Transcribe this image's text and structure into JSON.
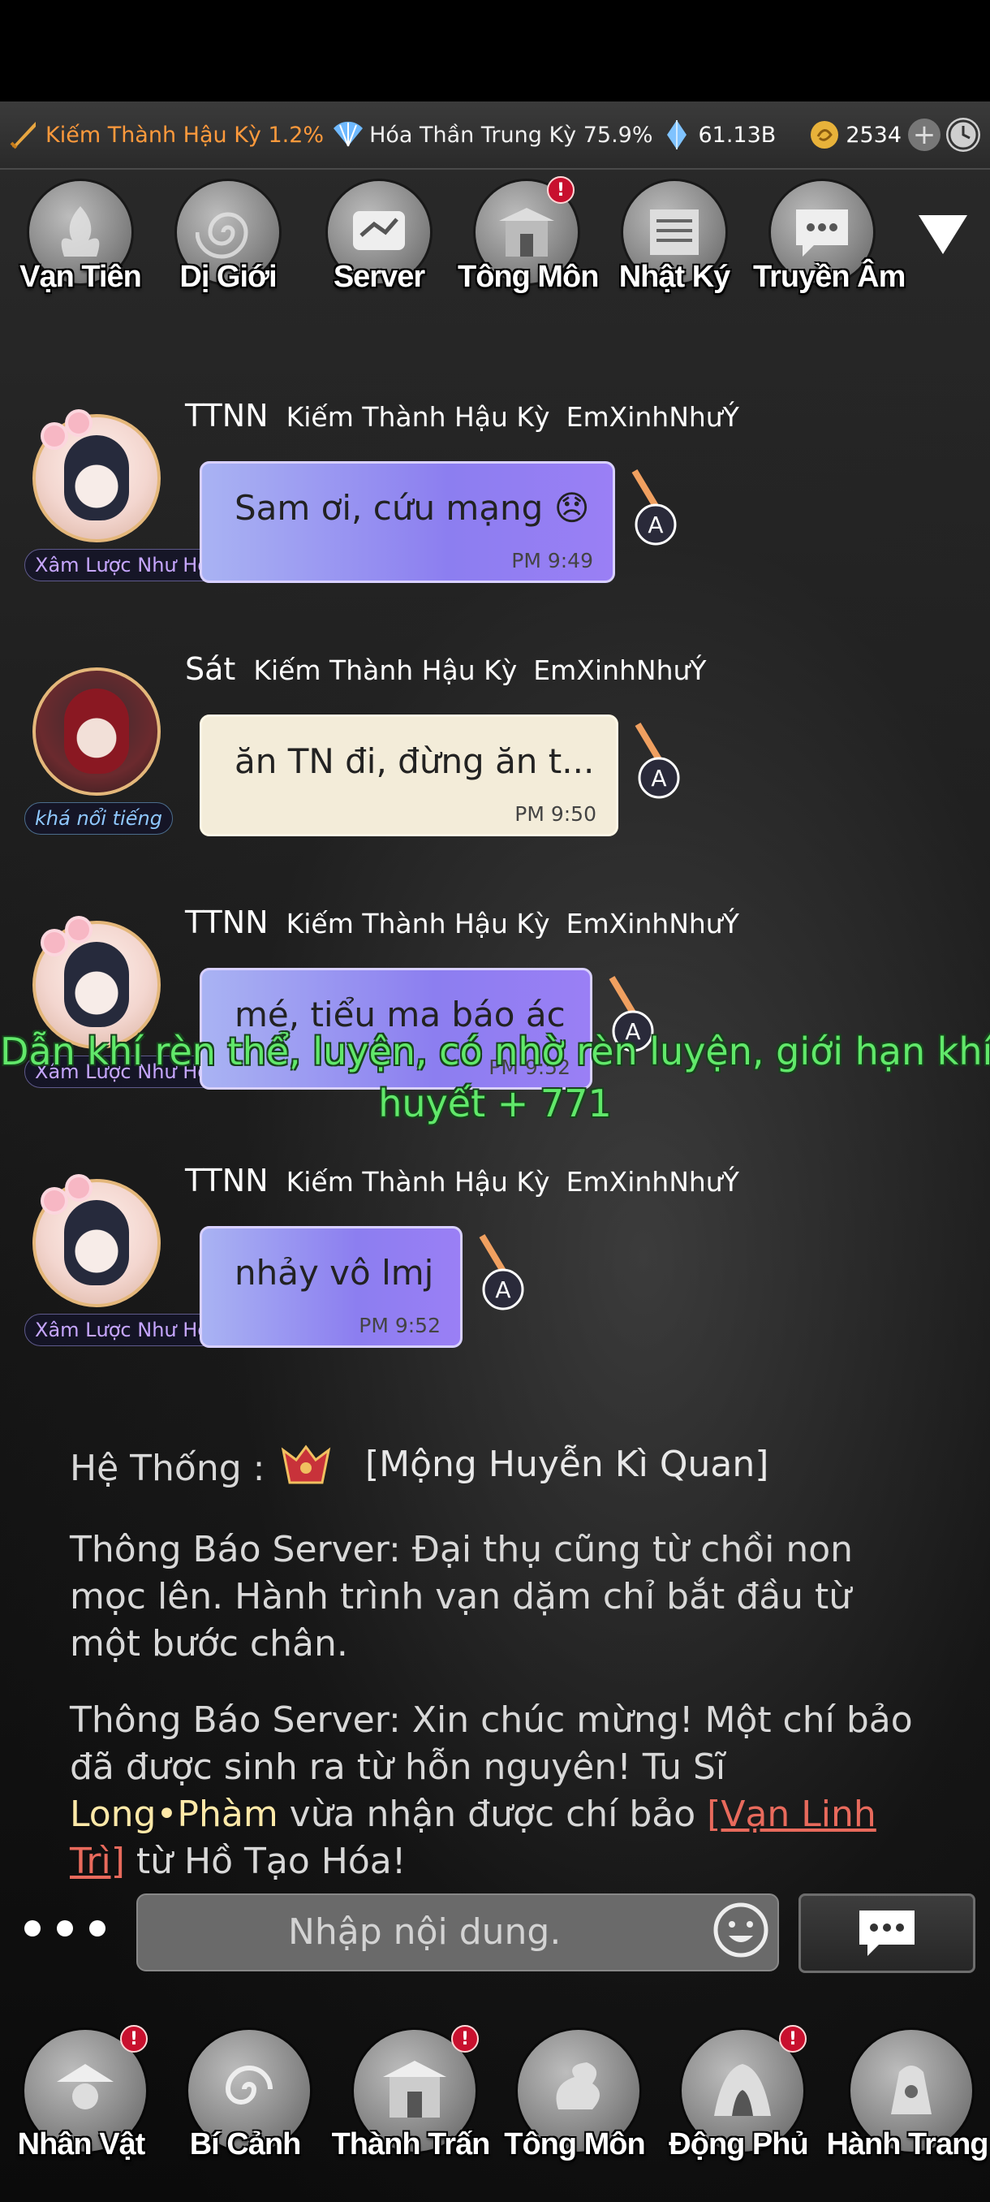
{
  "resources": {
    "cultivation_sword": "Kiếm Thành Hậu Kỳ 1.2%",
    "cultivation_fan": "Hóa Thần Trung Kỳ 75.9%",
    "spirit_stones": "61.13B",
    "coins": "2534"
  },
  "top_nav": [
    {
      "label": "Vạn Tiên"
    },
    {
      "label": "Dị Giới"
    },
    {
      "label": "Server"
    },
    {
      "label": "Tông Môn",
      "badge": "!"
    },
    {
      "label": "Nhật Ký"
    },
    {
      "label": "Truyền Âm"
    }
  ],
  "messages": [
    {
      "sender": "TTNN",
      "rank": "Kiếm Thành Hậu Kỳ",
      "guild": "EmXinhNhưÝ",
      "title": "Xâm Lược Như Hỏa",
      "text": "Sam ơi, cứu mạng 😞",
      "time": "PM 9:49"
    },
    {
      "sender": "Sát",
      "rank": "Kiếm Thành Hậu Kỳ",
      "guild": "EmXinhNhưÝ",
      "title": "khá nổi tiếng",
      "text": "ăn TN đi, đừng ăn t...",
      "time": "PM 9:50"
    },
    {
      "sender": "TTNN",
      "rank": "Kiếm Thành Hậu Kỳ",
      "guild": "EmXinhNhưÝ",
      "title": "Xâm Lược Như Hỏa",
      "text": "mé, tiểu ma báo ác",
      "time": "PM 9:52"
    },
    {
      "sender": "TTNN",
      "rank": "Kiếm Thành Hậu Kỳ",
      "guild": "EmXinhNhưÝ",
      "title": "Xâm Lược Như Hỏa",
      "text": "nhảy vô lmj",
      "time": "PM 9:52"
    }
  ],
  "overlay": {
    "line1": "Dẫn khí rèn thể, luyện, có nhờ rèn luyện, giới hạn khí",
    "line2": "huyết + 771"
  },
  "system": {
    "label": "Hệ Thống :",
    "item": "[Mộng Huyễn Kì Quan]",
    "ann1": "Thông Báo Server: Đại thụ cũng từ chồi non mọc lên. Hành trình vạn dặm chỉ bắt đầu từ một bước chân.",
    "ann2_prefix": "Thông Báo Server: Xin chúc mừng! Một chí bảo đã được sinh ra từ hỗn nguyên! Tu Sĩ ",
    "ann2_player": "Long•Phàm",
    "ann2_mid": " vừa nhận được chí bảo ",
    "ann2_item": "[Vạn Linh Trì]",
    "ann2_suffix": " từ Hồ Tạo Hóa!"
  },
  "input": {
    "placeholder": "Nhập nội dung."
  },
  "bottom_nav": [
    {
      "label": "Nhân Vật",
      "badge": "!"
    },
    {
      "label": "Bí Cảnh"
    },
    {
      "label": "Thành Trấn",
      "badge": "!"
    },
    {
      "label": "Tông Môn"
    },
    {
      "label": "Động Phủ",
      "badge": "!"
    },
    {
      "label": "Hành Trang"
    }
  ],
  "colors": {
    "accent_orange": "#ff9a3c",
    "bubble_purple": "#9a7ff5",
    "bubble_cream": "#f3ecd9",
    "green_text": "#61e86a",
    "badge_red": "#c8102e"
  },
  "icons": [
    "sword-icon",
    "fan-icon",
    "crystal-icon",
    "coin-icon",
    "plus-icon",
    "clock-icon",
    "collapse-triangle-icon",
    "emoji-icon",
    "chat-send-icon"
  ]
}
